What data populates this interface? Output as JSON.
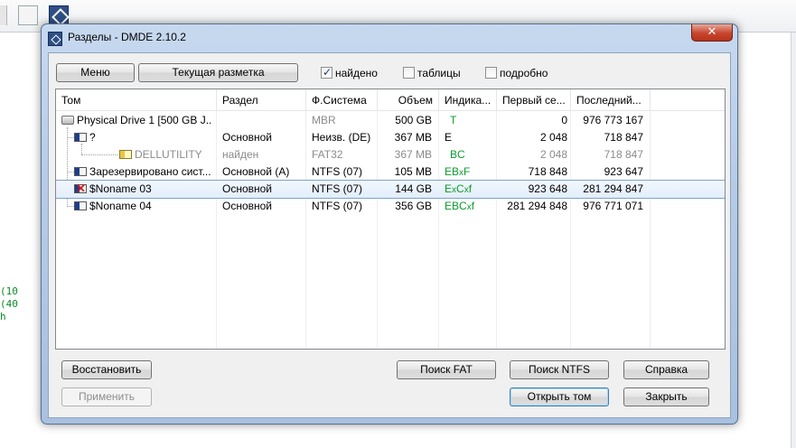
{
  "window": {
    "title": "Разделы - DMDE 2.10.2",
    "close_glyph": "✕"
  },
  "background": {
    "lines": [
      "(10",
      "(40",
      "h"
    ]
  },
  "top": {
    "menu_button": "Меню",
    "layout_button": "Текущая разметка",
    "check_found": {
      "label": "найдено",
      "checked": true
    },
    "check_tables": {
      "label": "таблицы",
      "checked": false
    },
    "check_detail": {
      "label": "подробно",
      "checked": false
    }
  },
  "columns": [
    "Том",
    "Раздел",
    "Ф.Система",
    "Объем",
    "Индика...",
    "Первый се...",
    "Последний..."
  ],
  "rows": [
    {
      "icon": "drive-icon",
      "name": "Physical Drive 1 [500 GB J...",
      "part": "",
      "fs": "MBR",
      "size": "500 GB",
      "ind": [
        "T"
      ],
      "first": "0",
      "last": "976 773 167",
      "gray": [
        "fs"
      ]
    },
    {
      "icon": "partition-icon",
      "name": "?",
      "part": "Основной",
      "fs": "Неизв. (DE)",
      "size": "367 MB",
      "ind": [
        "E"
      ],
      "first": "2 048",
      "last": "718 847",
      "gray": []
    },
    {
      "icon": "found-partition-icon",
      "name": "DELLUTILITY",
      "part": "найден",
      "fs": "FAT32",
      "size": "367 MB",
      "ind": [
        "B",
        "C"
      ],
      "first": "2 048",
      "last": "718 847",
      "gray": [
        "all"
      ]
    },
    {
      "icon": "partition-icon",
      "name": "Зарезервировано сист...",
      "part": "Основной (A)",
      "fs": "NTFS (07)",
      "size": "105 MB",
      "ind": [
        "E",
        "B",
        "x",
        "F"
      ],
      "first": "718 848",
      "last": "923 647",
      "gray": []
    },
    {
      "icon": "bad-partition-icon",
      "name": "$Noname 03",
      "part": "Основной",
      "fs": "NTFS (07)",
      "size": "144 GB",
      "ind": [
        "E",
        "x",
        "C",
        "x",
        "f"
      ],
      "first": "923 648",
      "last": "281 294 847",
      "gray": []
    },
    {
      "icon": "partition-icon",
      "name": "$Noname 04",
      "part": "Основной",
      "fs": "NTFS (07)",
      "size": "356 GB",
      "ind": [
        "E",
        "B",
        "C",
        "x",
        "f"
      ],
      "first": "281 294 848",
      "last": "976 771 071",
      "gray": []
    }
  ],
  "bottom": {
    "restore": "Восстановить",
    "apply": "Применить",
    "search_fat": "Поиск FAT",
    "search_ntfs": "Поиск NTFS",
    "help": "Справка",
    "open_volume": "Открыть том",
    "close": "Закрыть"
  },
  "colors": {
    "indicator_green": "#0b9b2c",
    "gray_text": "#8b8b8b",
    "selection": "#e2eefb"
  }
}
